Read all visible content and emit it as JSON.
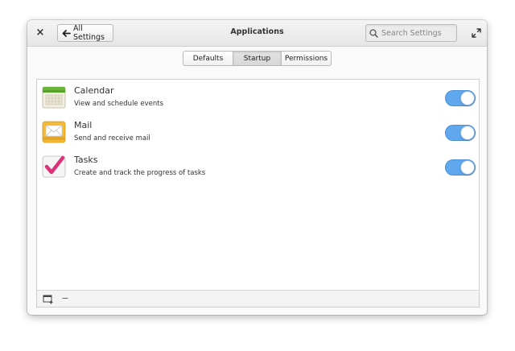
{
  "window": {
    "title": "Applications"
  },
  "titlebar": {
    "close_label": "×",
    "back_label": "All Settings",
    "search_placeholder": "Search Settings"
  },
  "tabs": [
    {
      "label": "Defaults",
      "selected": false
    },
    {
      "label": "Startup",
      "selected": true
    },
    {
      "label": "Permissions",
      "selected": false
    }
  ],
  "apps": [
    {
      "name": "Calendar",
      "description": "View and schedule events",
      "icon": "calendar-icon",
      "enabled": true
    },
    {
      "name": "Mail",
      "description": "Send and receive mail",
      "icon": "mail-icon",
      "enabled": true
    },
    {
      "name": "Tasks",
      "description": "Create and track the progress of tasks",
      "icon": "tasks-icon",
      "enabled": true
    }
  ],
  "bottombar": {
    "remove_label": "−"
  },
  "colors": {
    "accent": "#5fa8ee",
    "calendar_green": "#6ab437",
    "mail_orange": "#f4b935",
    "tasks_pink": "#d9337a"
  }
}
